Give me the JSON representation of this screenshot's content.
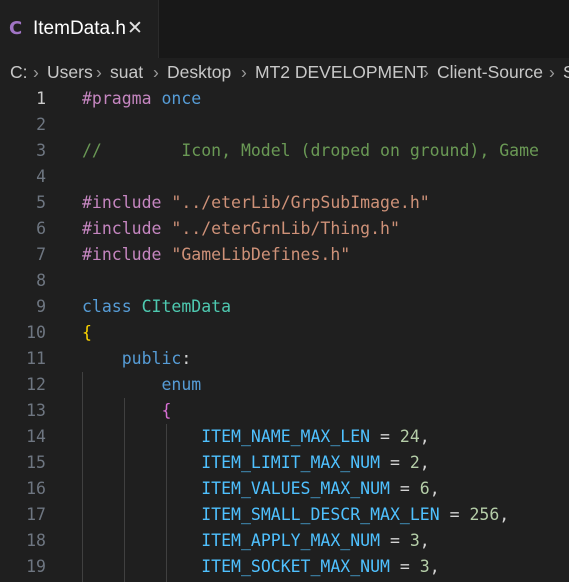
{
  "tab": {
    "lang_icon": "C",
    "title": "ItemData.h",
    "close": "✕"
  },
  "breadcrumb": {
    "items": [
      "C:",
      "Users",
      "suat",
      "Desktop",
      "MT2 DEVELOPMENT",
      "Client-Source",
      "S"
    ],
    "separator": "›"
  },
  "editor": {
    "active_line": 1,
    "lines": [
      {
        "n": "1",
        "parts": [
          [
            "pp",
            "#pragma"
          ],
          [
            "pl",
            " "
          ],
          [
            "kw",
            "once"
          ]
        ]
      },
      {
        "n": "2",
        "parts": []
      },
      {
        "n": "3",
        "parts": [
          [
            "cm",
            "//        Icon, Model (droped on ground), Game"
          ]
        ]
      },
      {
        "n": "4",
        "parts": []
      },
      {
        "n": "5",
        "parts": [
          [
            "pp",
            "#include"
          ],
          [
            "pl",
            " "
          ],
          [
            "str",
            "\"../eterLib/GrpSubImage.h\""
          ]
        ]
      },
      {
        "n": "6",
        "parts": [
          [
            "pp",
            "#include"
          ],
          [
            "pl",
            " "
          ],
          [
            "str",
            "\"../eterGrnLib/Thing.h\""
          ]
        ]
      },
      {
        "n": "7",
        "parts": [
          [
            "pp",
            "#include"
          ],
          [
            "pl",
            " "
          ],
          [
            "str",
            "\"GameLibDefines.h\""
          ]
        ]
      },
      {
        "n": "8",
        "parts": []
      },
      {
        "n": "9",
        "parts": [
          [
            "kw",
            "class"
          ],
          [
            "pl",
            " "
          ],
          [
            "ty",
            "CItemData"
          ]
        ]
      },
      {
        "n": "10",
        "parts": [
          [
            "br1",
            "{"
          ]
        ]
      },
      {
        "n": "11",
        "parts": [
          [
            "pl",
            "    "
          ],
          [
            "kw",
            "public"
          ],
          [
            "pl",
            ":"
          ]
        ]
      },
      {
        "n": "12",
        "parts": [
          [
            "pl",
            "        "
          ],
          [
            "kw",
            "enum"
          ]
        ]
      },
      {
        "n": "13",
        "parts": [
          [
            "pl",
            "        "
          ],
          [
            "br2",
            "{"
          ]
        ]
      },
      {
        "n": "14",
        "parts": [
          [
            "pl",
            "            "
          ],
          [
            "en",
            "ITEM_NAME_MAX_LEN"
          ],
          [
            "op",
            " = "
          ],
          [
            "num",
            "24"
          ],
          [
            "pl",
            ","
          ]
        ]
      },
      {
        "n": "15",
        "parts": [
          [
            "pl",
            "            "
          ],
          [
            "en",
            "ITEM_LIMIT_MAX_NUM"
          ],
          [
            "op",
            " = "
          ],
          [
            "num",
            "2"
          ],
          [
            "pl",
            ","
          ]
        ]
      },
      {
        "n": "16",
        "parts": [
          [
            "pl",
            "            "
          ],
          [
            "en",
            "ITEM_VALUES_MAX_NUM"
          ],
          [
            "op",
            " = "
          ],
          [
            "num",
            "6"
          ],
          [
            "pl",
            ","
          ]
        ]
      },
      {
        "n": "17",
        "parts": [
          [
            "pl",
            "            "
          ],
          [
            "en",
            "ITEM_SMALL_DESCR_MAX_LEN"
          ],
          [
            "op",
            " = "
          ],
          [
            "num",
            "256"
          ],
          [
            "pl",
            ","
          ]
        ]
      },
      {
        "n": "18",
        "parts": [
          [
            "pl",
            "            "
          ],
          [
            "en",
            "ITEM_APPLY_MAX_NUM"
          ],
          [
            "op",
            " = "
          ],
          [
            "num",
            "3"
          ],
          [
            "pl",
            ","
          ]
        ]
      },
      {
        "n": "19",
        "parts": [
          [
            "pl",
            "            "
          ],
          [
            "en",
            "ITEM_SOCKET_MAX_NUM"
          ],
          [
            "op",
            " = "
          ],
          [
            "num",
            "3"
          ],
          [
            "pl",
            ","
          ]
        ]
      }
    ]
  },
  "colors": {
    "background": "#1f1f1f",
    "tabbar": "#181818",
    "keyword": "#569cd6",
    "preprocessor": "#c586c0",
    "string": "#ce9178",
    "comment": "#6a9955",
    "type": "#4ec9b0",
    "enum_member": "#4fc1ff",
    "number": "#b5cea8"
  }
}
